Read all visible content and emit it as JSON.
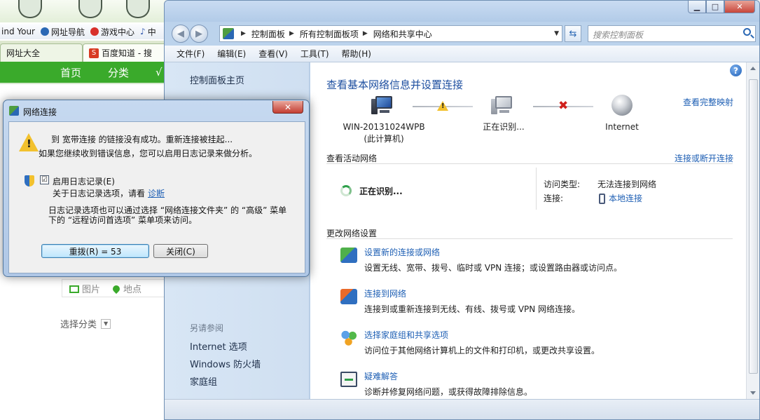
{
  "background_browser": {
    "bookmarks": [
      "ind Your",
      "网址导航",
      "游戏中心",
      "中"
    ],
    "tabs": [
      "网址大全",
      "百度知道 - 搜"
    ],
    "nav": [
      "首页",
      "分类",
      "√"
    ],
    "media_tabs": [
      "图片",
      "地点"
    ],
    "category_select": "选择分类"
  },
  "main_window": {
    "caption_buttons": {
      "minimize": "▁",
      "maximize": "□",
      "close": "✕"
    },
    "breadcrumb": [
      "控制面板",
      "所有控制面板项",
      "网络和共享中心"
    ],
    "search_placeholder": "搜索控制面板",
    "menu": [
      "文件(F)",
      "编辑(E)",
      "查看(V)",
      "工具(T)",
      "帮助(H)"
    ],
    "left_pane": {
      "home_link": "控制面板主页",
      "see_also_heading": "另请参阅",
      "see_also": [
        "Internet 选项",
        "Windows 防火墙",
        "家庭组"
      ]
    },
    "content": {
      "help_icon": "?",
      "title": "查看基本网络信息并设置连接",
      "full_map_link": "查看完整映射",
      "map": {
        "computer_name": "WIN-20131024WPB",
        "computer_sub": "(此计算机)",
        "middle_label": "正在识别...",
        "internet_label": "Internet"
      },
      "active_networks_heading": "查看活动网络",
      "connect_disconnect_link": "连接或断开连接",
      "identifying_status": "正在识别...",
      "access_type_key": "访问类型:",
      "access_type_value": "无法连接到网络",
      "connection_key": "连接:",
      "connection_value": "本地连接",
      "change_settings_heading": "更改网络设置",
      "tasks": [
        {
          "link": "设置新的连接或网络",
          "desc": "设置无线、宽带、拨号、临时或 VPN 连接；或设置路由器或访问点。"
        },
        {
          "link": "连接到网络",
          "desc": "连接到或重新连接到无线、有线、拨号或 VPN 网络连接。"
        },
        {
          "link": "选择家庭组和共享选项",
          "desc": "访问位于其他网络计算机上的文件和打印机，或更改共享设置。"
        },
        {
          "link": "疑难解答",
          "desc": "诊断并修复网络问题，或获得故障排除信息。"
        }
      ]
    }
  },
  "dialog": {
    "title": "网络连接",
    "close": "✕",
    "message_line1": "到 宽带连接 的链接没有成功。重新连接被挂起...",
    "message_line2": "如果您继续收到错误信息，您可以启用日志记录来做分析。",
    "enable_logging_label": "启用日志记录(E)",
    "enable_logging_checked": "☑",
    "log_options_text": "关于日志记录选项，请看",
    "diagnose_link": "诊断",
    "note_line1": "日志记录选项也可以通过选择 “网络连接文件夹” 的 “高级” 菜单",
    "note_line2": "下的 “远程访问首选项” 菜单项来访问。",
    "redial_button": "重拨(R) = 53",
    "close_button": "关闭(C)"
  }
}
